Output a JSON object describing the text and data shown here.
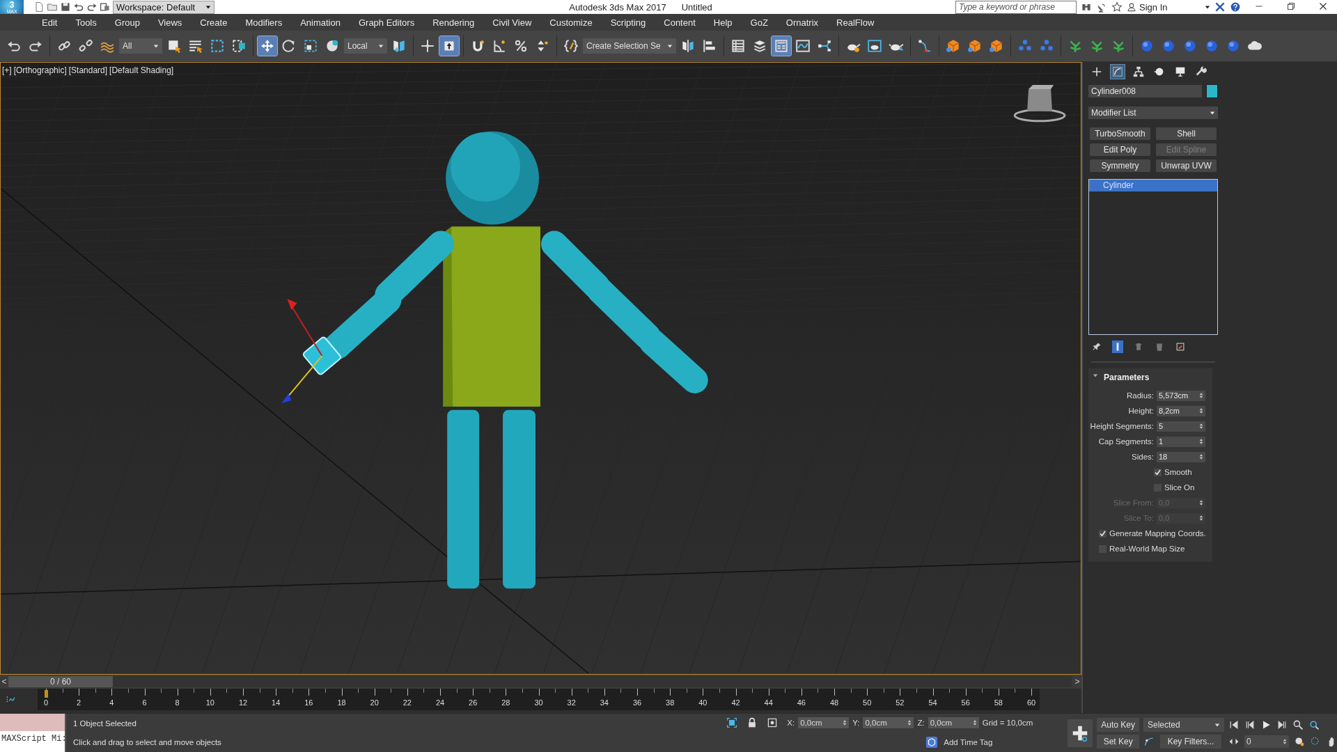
{
  "title_bar": {
    "logo": "3",
    "logo_sub": "MAX",
    "workspace": "Workspace: Default",
    "app_title": "Autodesk 3ds Max 2017",
    "document": "Untitled",
    "search_placeholder": "Type a keyword or phrase",
    "sign_in": "Sign In"
  },
  "menu": [
    "Edit",
    "Tools",
    "Group",
    "Views",
    "Create",
    "Modifiers",
    "Animation",
    "Graph Editors",
    "Rendering",
    "Civil View",
    "Customize",
    "Scripting",
    "Content",
    "Help",
    "GoZ",
    "Ornatrix",
    "RealFlow"
  ],
  "toolbar": [
    {
      "kind": "undo"
    },
    {
      "kind": "redo"
    },
    {
      "kind": "separator"
    },
    {
      "kind": "link"
    },
    {
      "kind": "unlink"
    },
    {
      "kind": "bind"
    },
    {
      "kind": "dropdown",
      "value": "All"
    },
    {
      "kind": "select",
      "selected": false
    },
    {
      "kind": "select-by-name"
    },
    {
      "kind": "rect-region"
    },
    {
      "kind": "window-crossing"
    },
    {
      "kind": "separator"
    },
    {
      "kind": "move",
      "selected": true
    },
    {
      "kind": "rotate",
      "selected": false
    },
    {
      "kind": "scale",
      "selected": false
    },
    {
      "kind": "place",
      "selected": false
    },
    {
      "kind": "dropdown",
      "value": "Local"
    },
    {
      "kind": "pivot"
    },
    {
      "kind": "separator"
    },
    {
      "kind": "manipulate"
    },
    {
      "kind": "keyboard",
      "selected": true
    },
    {
      "kind": "separator"
    },
    {
      "kind": "snap"
    },
    {
      "kind": "angle"
    },
    {
      "kind": "percent"
    },
    {
      "kind": "spinner"
    },
    {
      "kind": "separator"
    },
    {
      "kind": "named-sets"
    },
    {
      "kind": "dropdown",
      "value": "Create Selection Se"
    },
    {
      "kind": "mirror"
    },
    {
      "kind": "align"
    },
    {
      "kind": "separator"
    },
    {
      "kind": "table"
    },
    {
      "kind": "layers"
    },
    {
      "kind": "ribbon",
      "selected": true
    },
    {
      "kind": "curve"
    },
    {
      "kind": "schematic"
    },
    {
      "kind": "separator"
    },
    {
      "kind": "render-setup"
    },
    {
      "kind": "frame-window"
    },
    {
      "kind": "render"
    },
    {
      "kind": "separator"
    },
    {
      "kind": "bone"
    },
    {
      "kind": "separator"
    },
    {
      "kind": "cube"
    },
    {
      "kind": "cube"
    },
    {
      "kind": "cube"
    },
    {
      "kind": "separator"
    },
    {
      "kind": "dots"
    },
    {
      "kind": "dots"
    },
    {
      "kind": "separator"
    },
    {
      "kind": "plant"
    },
    {
      "kind": "plant"
    },
    {
      "kind": "plant"
    },
    {
      "kind": "separator"
    },
    {
      "kind": "sphere"
    },
    {
      "kind": "sphere"
    },
    {
      "kind": "sphere"
    },
    {
      "kind": "sphere"
    },
    {
      "kind": "sphere"
    },
    {
      "kind": "cloud"
    }
  ],
  "viewport": {
    "labels": [
      "[+]",
      "[Orthographic]",
      "[Standard]",
      "[Default Shading]"
    ]
  },
  "command_panel": {
    "tabs": [
      {
        "kind": "create",
        "selected": false
      },
      {
        "kind": "modify",
        "selected": true
      },
      {
        "kind": "hierarchy",
        "selected": false
      },
      {
        "kind": "motion",
        "selected": false
      },
      {
        "kind": "display",
        "selected": false
      },
      {
        "kind": "utilities",
        "selected": false
      }
    ],
    "object": {
      "name": "Cylinder008",
      "color": "#2bb7c9"
    },
    "modifier_list": "Modifier List",
    "modifier_buttons": [
      {
        "label": "TurboSmooth",
        "disabled": false
      },
      {
        "label": "Shell",
        "disabled": false
      },
      {
        "label": "Edit Poly",
        "disabled": false
      },
      {
        "label": "Edit Spline",
        "disabled": true
      },
      {
        "label": "Symmetry",
        "disabled": false
      },
      {
        "label": "Unwrap UVW",
        "disabled": false
      }
    ],
    "stack": [
      {
        "label": "Cylinder",
        "selected": true
      }
    ],
    "stack_tools": [
      {
        "kind": "pin",
        "on": false
      },
      {
        "kind": "result",
        "on": true
      },
      {
        "kind": "unique",
        "on": false
      },
      {
        "kind": "remove",
        "on": false
      },
      {
        "kind": "configure",
        "on": false
      }
    ],
    "rollout": {
      "title": "Parameters",
      "expanded": true,
      "rows": [
        {
          "kind": "spinner",
          "label": "Radius:",
          "value": "5,573cm",
          "disabled": false
        },
        {
          "kind": "spinner",
          "label": "Height:",
          "value": "8,2cm",
          "disabled": false
        },
        {
          "kind": "spinner",
          "label": "Height Segments:",
          "value": "5",
          "disabled": false
        },
        {
          "kind": "spinner",
          "label": "Cap Segments:",
          "value": "1",
          "disabled": false
        },
        {
          "kind": "spinner",
          "label": "Sides:",
          "value": "18",
          "disabled": false
        },
        {
          "kind": "checkbox",
          "label": "Smooth",
          "checked": true
        },
        {
          "kind": "checkbox",
          "label": "Slice On",
          "checked": false
        },
        {
          "kind": "spinner",
          "label": "Slice From:",
          "value": "0,0",
          "disabled": true
        },
        {
          "kind": "spinner",
          "label": "Slice To:",
          "value": "0,0",
          "disabled": true
        },
        {
          "kind": "wide-checkbox",
          "label": "Generate Mapping Coords.",
          "checked": true
        },
        {
          "kind": "wide-checkbox",
          "label": "Real-World Map Size",
          "checked": false
        }
      ]
    }
  },
  "timeline": {
    "slider": {
      "label": "0 / 60",
      "level": 0
    },
    "prev": "<",
    "next": ">",
    "ticks": [
      "0",
      "2",
      "4",
      "6",
      "8",
      "10",
      "12",
      "14",
      "16",
      "18",
      "20",
      "22",
      "24",
      "26",
      "28",
      "30",
      "32",
      "34",
      "36",
      "38",
      "40",
      "42",
      "44",
      "46",
      "48",
      "50",
      "52",
      "54",
      "56",
      "58",
      "60"
    ]
  },
  "status": {
    "listener": "MAXScript Mi:",
    "selection": "1 Object Selected",
    "prompt": "Click and drag to select and move objects",
    "coords": [
      {
        "axis": "X:",
        "value": "0,0cm"
      },
      {
        "axis": "Y:",
        "value": "0,0cm"
      },
      {
        "axis": "Z:",
        "value": "0,0cm"
      }
    ],
    "grid": "Grid = 10,0cm",
    "time_tag": "Add Time Tag",
    "auto_key": "Auto Key",
    "set_key": "Set Key",
    "key_mode": "Selected",
    "key_filters": "Key Filters...",
    "frame": "0"
  }
}
